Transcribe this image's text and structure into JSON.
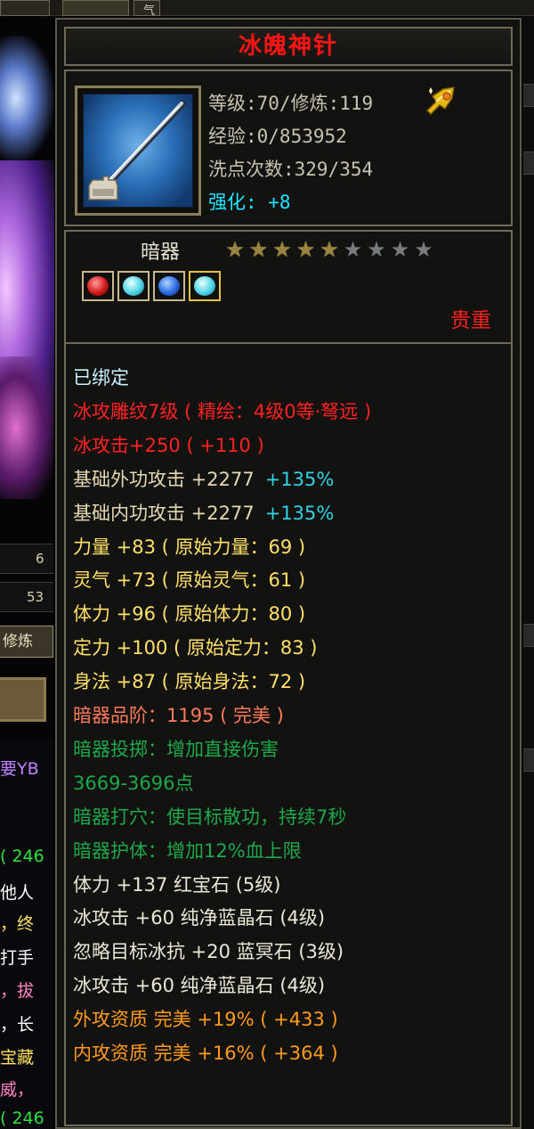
{
  "background": {
    "tab_text": "气",
    "numbers": [
      "6",
      "53"
    ],
    "cultivate_button": "修炼",
    "chat": [
      {
        "text": "要YB",
        "color": "#c080ff"
      },
      {
        "text": "( 246",
        "color": "#30e040"
      },
      {
        "text": "他人",
        "color": "#ffffff"
      },
      {
        "text": "，终",
        "color": "#ffe060"
      },
      {
        "text": "打手",
        "color": "#ffffff"
      },
      {
        "text": "，拔",
        "color": "#ff80c0"
      },
      {
        "text": "，长",
        "color": "#ffffff"
      },
      {
        "text": "宝藏",
        "color": "#ffe060"
      },
      {
        "text": "威，",
        "color": "#ff80c0"
      },
      {
        "text": "( 246",
        "color": "#30e040"
      }
    ]
  },
  "tooltip": {
    "item_name": "冰魄神针",
    "level_line": "等级:70/修炼:119",
    "exp_line": "经验:0/853952",
    "reset_line": "洗点次数:329/354",
    "enhance_line": "强化: +8",
    "type_label": "暗器",
    "stars_total": 9,
    "stars_filled": 5,
    "gems": [
      "red",
      "cyan",
      "blue",
      "cyan"
    ],
    "rarity": "贵重",
    "attributes": [
      {
        "text": "已绑定",
        "color": "cyan"
      },
      {
        "text": "冰攻雕纹7级 ( 精绘：4级0等·弩远 )",
        "color": "red"
      },
      {
        "text": "冰攻击+250 ( +110 )",
        "color": "red"
      },
      {
        "text": "基础外功攻击 +2277",
        "pct": "+135%",
        "color": "tan"
      },
      {
        "text": "基础内功攻击 +2277",
        "pct": "+135%",
        "color": "tan"
      },
      {
        "text": "力量 +83 ( 原始力量：69 )",
        "color": "yellow"
      },
      {
        "text": "灵气 +73 ( 原始灵气：61 )",
        "color": "yellow"
      },
      {
        "text": "体力 +96 ( 原始体力：80 )",
        "color": "yellow"
      },
      {
        "text": "定力 +100 ( 原始定力：83 )",
        "color": "yellow"
      },
      {
        "text": "身法 +87 ( 原始身法：72 )",
        "color": "yellow"
      },
      {
        "text": "暗器品阶：1195 ( 完美 )",
        "color": "salmon"
      },
      {
        "text": "暗器投掷：增加直接伤害",
        "color": "green"
      },
      {
        "text": "3669-3696点",
        "color": "green"
      },
      {
        "text": "暗器打穴：使目标散功，持续7秒",
        "color": "green"
      },
      {
        "text": "暗器护体：增加12%血上限",
        "color": "green"
      },
      {
        "text": "体力 +137 红宝石 (5级)",
        "color": "white"
      },
      {
        "text": "冰攻击 +60 纯净蓝晶石 (4级)",
        "color": "white"
      },
      {
        "text": "忽略目标冰抗 +20 蓝冥石 (3级)",
        "color": "white"
      },
      {
        "text": "冰攻击 +60 纯净蓝晶石 (4级)",
        "color": "white"
      },
      {
        "text": "外攻资质  完美 +19% ( +433 )",
        "color": "orange"
      },
      {
        "text": "内攻资质  完美 +16% ( +364 )",
        "color": "orange"
      }
    ]
  },
  "colors": {
    "title_red": "#ff1414",
    "enhance_cyan": "#1ee6ff",
    "frame_border": "#6f6a58"
  }
}
